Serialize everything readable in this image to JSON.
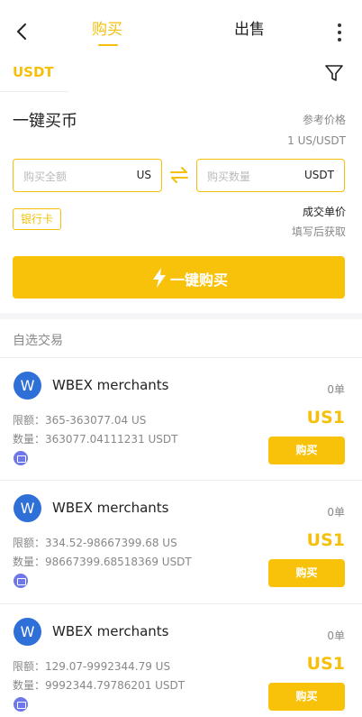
{
  "header": {
    "tabs": [
      "购买",
      "出售"
    ]
  },
  "coin_tab": "USDT",
  "quick": {
    "title": "一键买币",
    "ref_label": "参考价格",
    "ref_value": "1 US/USDT",
    "amount_placeholder": "购买全额",
    "amount_unit": "US",
    "qty_placeholder": "购买数量",
    "qty_unit": "USDT",
    "pay_method": "银行卡",
    "unit_price_label": "成交单价",
    "unit_price_hint": "填写后获取",
    "buy_button": "一键购买"
  },
  "list": {
    "title": "自选交易",
    "merchants": [
      {
        "avatar": "W",
        "name": "WBEX merchants",
        "orders": "0单",
        "limit": "限额：365-363077.04 US",
        "qty": "数量：363077.04111231 USDT",
        "price": "US1",
        "buy": "购买"
      },
      {
        "avatar": "W",
        "name": "WBEX merchants",
        "orders": "0单",
        "limit": "限额：334.52-98667399.68 US",
        "qty": "数量：98667399.68518369 USDT",
        "price": "US1",
        "buy": "购买"
      },
      {
        "avatar": "W",
        "name": "WBEX merchants",
        "orders": "0单",
        "limit": "限额：129.07-9992344.79 US",
        "qty": "数量：9992344.79786201 USDT",
        "price": "US1",
        "buy": "购买"
      }
    ]
  },
  "colors": {
    "accent": "#f5bf0a",
    "avatar": "#2f6fd8",
    "pay_icon": "#6d77e8"
  },
  "icons": [
    "back-arrow-icon",
    "more-vertical-icon",
    "filter-icon",
    "swap-icon",
    "lightning-icon",
    "bank-card-icon"
  ]
}
